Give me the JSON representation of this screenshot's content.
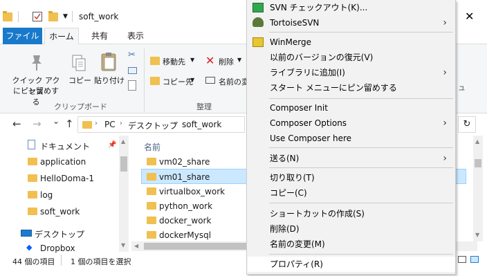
{
  "window": {
    "title": "soft_work",
    "close_glyph": "✕"
  },
  "ribbon": {
    "tabs": {
      "file": "ファイル",
      "home": "ホーム",
      "share": "共有",
      "view": "表示"
    },
    "clipboard": {
      "quick_access_line1": "クイック アクセス",
      "quick_access_line2": "にピン留めする",
      "copy": "コピー",
      "paste": "貼り付け",
      "group_label": "クリップボード"
    },
    "organize": {
      "move_to": "移動先",
      "copy_to": "コピー先",
      "delete": "削除",
      "rename": "名前の変",
      "group_label": "整理"
    },
    "partial_right": "ュ"
  },
  "nav": {
    "back": "←",
    "forward": "→",
    "dropdown": "⌄",
    "up": "↑",
    "breadcrumb": [
      "PC",
      "デスクトップ",
      "soft_work"
    ],
    "refresh": "↻"
  },
  "sidebar": {
    "items": [
      {
        "label": "ドキュメント",
        "icon": "document-icon",
        "pinned": true
      },
      {
        "label": "application",
        "icon": "folder-icon"
      },
      {
        "label": "HelloDoma-1",
        "icon": "folder-icon"
      },
      {
        "label": "log",
        "icon": "folder-icon"
      },
      {
        "label": "soft_work",
        "icon": "folder-icon"
      },
      {
        "label": "デスクトップ",
        "icon": "desktop-icon"
      },
      {
        "label": "Dropbox",
        "icon": "dropbox-icon"
      }
    ]
  },
  "file_list": {
    "column_name": "名前",
    "items": [
      {
        "name": "vm02_share",
        "selected": false
      },
      {
        "name": "vm01_share",
        "selected": true
      },
      {
        "name": "virtualbox_work",
        "selected": false
      },
      {
        "name": "python_work",
        "selected": false
      },
      {
        "name": "docker_work",
        "selected": false
      },
      {
        "name": "dockerMysql",
        "selected": false
      }
    ]
  },
  "status_bar": {
    "item_count": "44 個の項目",
    "selected_count": "1 個の項目を選択"
  },
  "context_menu": {
    "items": [
      {
        "label": "SVN チェックアウト(K)...",
        "icon": "svn-checkout-icon"
      },
      {
        "label": "TortoiseSVN",
        "icon": "tortoise-icon",
        "submenu": true
      },
      {
        "label": "WinMerge",
        "icon": "winmerge-icon"
      },
      {
        "label": "以前のバージョンの復元(V)"
      },
      {
        "label": "ライブラリに追加(I)",
        "submenu": true
      },
      {
        "label": "スタート メニューにピン留めする"
      },
      {
        "label": "Composer Init"
      },
      {
        "label": "Composer Options",
        "submenu": true
      },
      {
        "label": "Use Composer here"
      },
      {
        "label": "送る(N)",
        "submenu": true
      },
      {
        "label": "切り取り(T)"
      },
      {
        "label": "コピー(C)"
      },
      {
        "label": "ショートカットの作成(S)"
      },
      {
        "label": "削除(D)"
      },
      {
        "label": "名前の変更(M)"
      },
      {
        "label": "プロパティ(R)"
      }
    ]
  },
  "colors": {
    "file_tab": "#1979ca",
    "selection": "#cce8ff",
    "menu_bg": "#f2f2f2",
    "folder": "#f0c050"
  }
}
